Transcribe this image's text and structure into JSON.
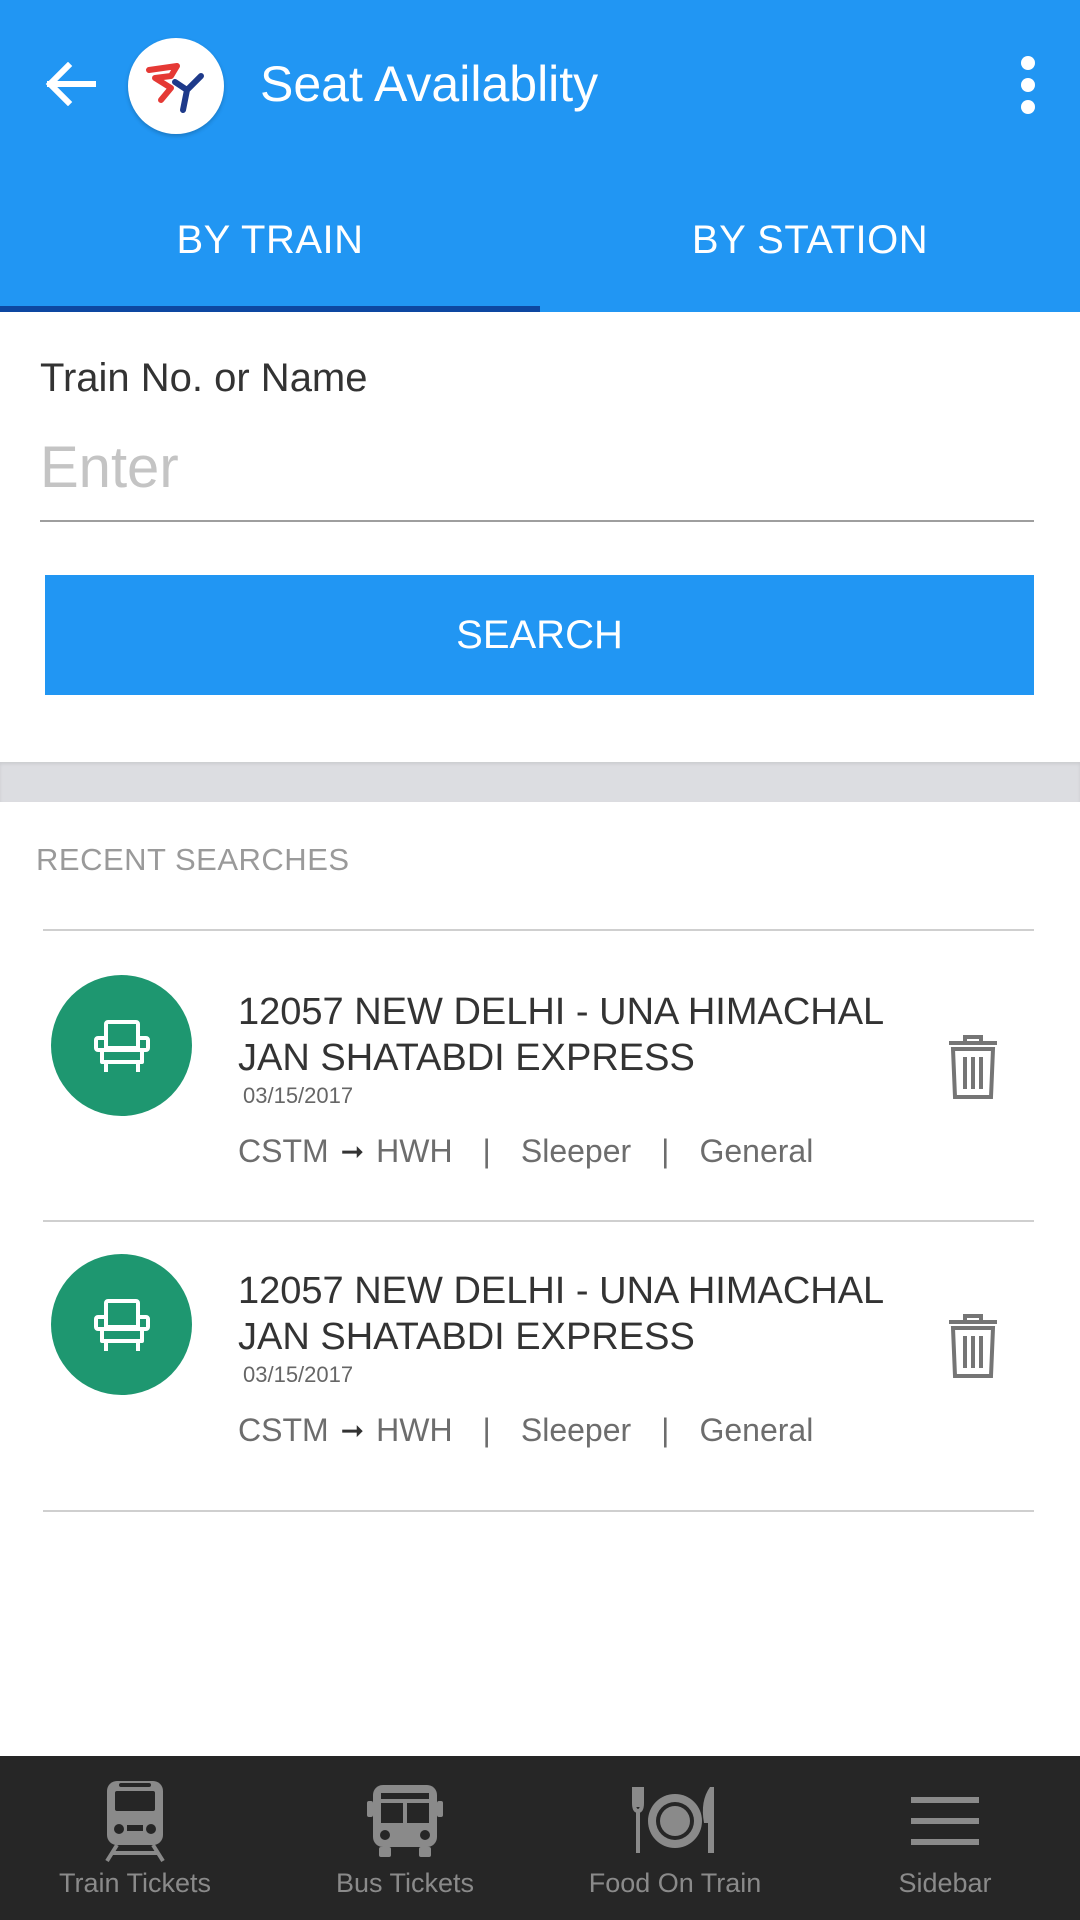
{
  "header": {
    "title": "Seat Availablity",
    "color": "#2196f3"
  },
  "tabs": [
    {
      "label": "BY TRAIN",
      "selected": true
    },
    {
      "label": "BY STATION",
      "selected": false
    }
  ],
  "form": {
    "label": "Train No. or Name",
    "input_value": "",
    "input_placeholder": "Enter",
    "search_label": "SEARCH"
  },
  "recent": {
    "title": "RECENT SEARCHES",
    "items": [
      {
        "name": "12057 NEW DELHI - UNA HIMACHAL JAN SHATABDI EXPRESS",
        "date": "03/15/2017",
        "from": "CSTM",
        "to": "HWH",
        "class": "Sleeper",
        "quota": "General",
        "icon": "seat-icon",
        "icon_color": "#1e9770"
      },
      {
        "name": "12057 NEW DELHI - UNA HIMACHAL JAN SHATABDI EXPRESS",
        "date": "03/15/2017",
        "from": "CSTM",
        "to": "HWH",
        "class": "Sleeper",
        "quota": "General",
        "icon": "seat-icon",
        "icon_color": "#1e9770"
      }
    ]
  },
  "bottom_nav": [
    {
      "label": "Train Tickets",
      "icon": "train-icon"
    },
    {
      "label": "Bus Tickets",
      "icon": "bus-icon"
    },
    {
      "label": "Food On Train",
      "icon": "food-icon"
    },
    {
      "label": "Sidebar",
      "icon": "menu-icon"
    }
  ]
}
